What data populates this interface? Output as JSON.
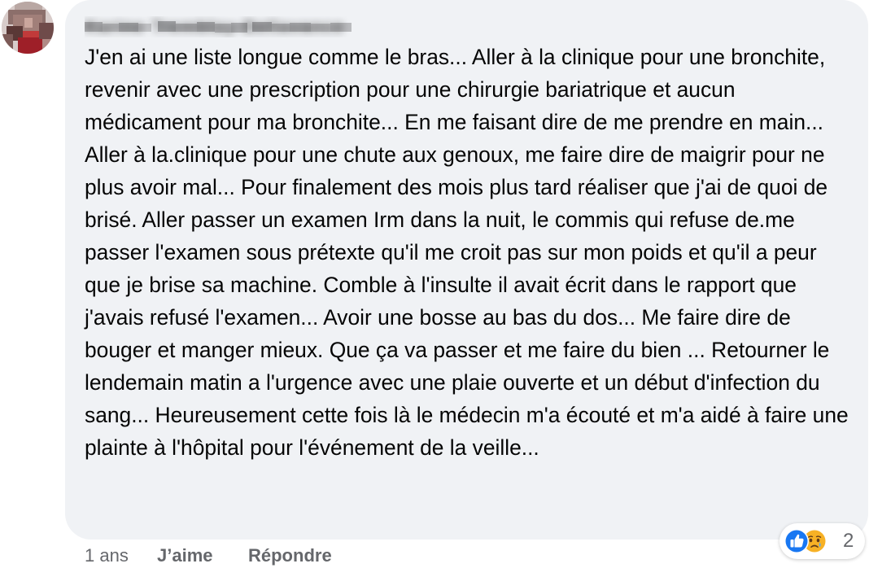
{
  "comment": {
    "author": "Karine Tremblay-Bellavance",
    "text": "J'en ai une liste longue comme le bras... Aller à la clinique pour une bronchite, revenir avec une prescription pour une chirurgie bariatrique et aucun médicament pour ma bronchite... En me faisant dire de me prendre en main... Aller à la.clinique pour une chute aux genoux, me faire dire de maigrir pour ne plus avoir mal... Pour finalement des mois plus tard réaliser que j'ai de quoi de brisé. Aller passer un examen Irm dans la nuit, le commis qui refuse de.me passer l'examen sous prétexte qu'il me croit pas sur mon poids et qu'il a peur que je brise sa machine. Comble à l'insulte il avait écrit dans le rapport que j'avais refusé l'examen... Avoir une bosse au bas du dos... Me faire dire de bouger et manger mieux. Que ça va passer et me faire du bien ... Retourner le lendemain matin a l'urgence avec une plaie ouverte et un début d'infection du sang... Heureusement cette fois là le médecin m'a écouté et m'a aidé à faire une plainte à l'hôpital pour l'événement de la veille...",
    "reactions": {
      "icons": [
        "like-icon",
        "sad-icon"
      ],
      "count": "2"
    },
    "actions": {
      "time": "1 ans",
      "like_label": "J’aime",
      "reply_label": "Répondre"
    }
  },
  "colors": {
    "bubble_bg": "#f0f2f5",
    "text": "#050505",
    "secondary_text": "#65676b",
    "like_blue": "#1877f2",
    "sad_yellow": "#f7b125"
  }
}
